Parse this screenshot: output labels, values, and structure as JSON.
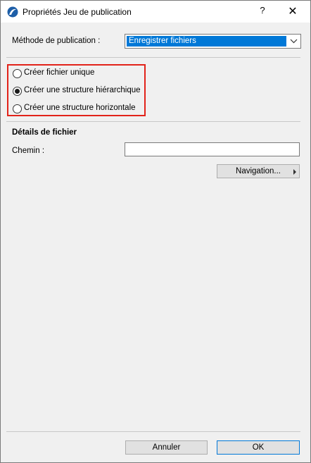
{
  "window": {
    "title": "Propriétés Jeu de publication",
    "help_label": "?",
    "close_label": "✕"
  },
  "method": {
    "label": "Méthode de publication :",
    "selected": "Enregistrer fichiers"
  },
  "structure_options": [
    {
      "label": "Créer fichier unique",
      "selected": false
    },
    {
      "label": "Créer une structure hiérarchique",
      "selected": true
    },
    {
      "label": "Créer une structure horizontale",
      "selected": false
    }
  ],
  "file_details": {
    "section_title": "Détails de fichier",
    "path_label": "Chemin :",
    "path_value": "",
    "browse_button": "Navigation..."
  },
  "footer": {
    "cancel_label": "Annuler",
    "ok_label": "OK"
  },
  "colors": {
    "highlight_box": "#e2231a",
    "selection": "#0078d7"
  }
}
